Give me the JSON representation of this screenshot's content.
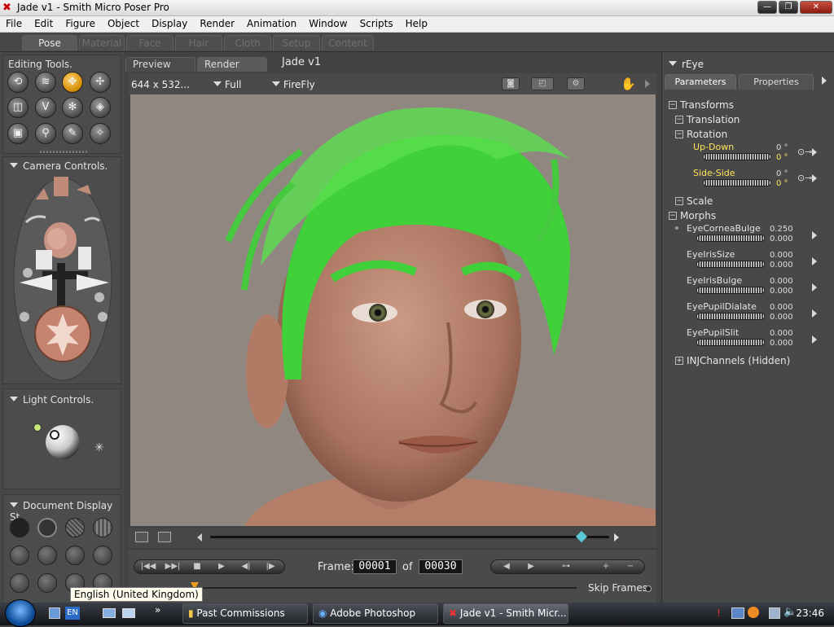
{
  "window": {
    "title": "Jade v1 - Smith Micro Poser Pro",
    "icon": "poser-icon"
  },
  "menu": [
    "File",
    "Edit",
    "Figure",
    "Object",
    "Display",
    "Render",
    "Animation",
    "Window",
    "Scripts",
    "Help"
  ],
  "rooms": [
    {
      "label": "Pose",
      "active": true
    },
    {
      "label": "Material",
      "active": false
    },
    {
      "label": "Face",
      "active": false
    },
    {
      "label": "Hair",
      "active": false
    },
    {
      "label": "Cloth",
      "active": false
    },
    {
      "label": "Setup",
      "active": false
    },
    {
      "label": "Content",
      "active": false
    }
  ],
  "left": {
    "editing_title": "Editing Tools.",
    "tools": [
      "rotate",
      "twist",
      "translate",
      "translate-in-out",
      "scale",
      "taper",
      "chain-break",
      "color",
      "view-magnifier",
      "direct-manipulation",
      "morphing",
      "grouping"
    ],
    "selected_tool": "translate",
    "camera_title": "Camera Controls.",
    "light_title": "Light Controls.",
    "doc_display_title": "Document Display St"
  },
  "document": {
    "tabs": [
      {
        "label": "Preview",
        "active": false
      },
      {
        "label": "Render",
        "active": true
      }
    ],
    "title": "Jade v1",
    "size": "644 x 532...",
    "quality": "Full",
    "renderer": "FireFly",
    "frame_label": "Frame:",
    "frame_current": "00001",
    "frame_of": "of",
    "frame_total": "00030",
    "skip_frames": "Skip Frames",
    "timeline_position": 0.93
  },
  "params": {
    "actor": "rEye",
    "tabs": [
      {
        "label": "Parameters",
        "active": true
      },
      {
        "label": "Properties",
        "active": false
      }
    ],
    "groups": {
      "transforms": "Transforms",
      "translation": "Translation",
      "rotation": "Rotation",
      "scale": "Scale",
      "morphs": "Morphs",
      "inj": "INJChannels (Hidden)"
    },
    "rotation_dials": [
      {
        "name": "Up-Down",
        "value": "0 °",
        "value2": "0 °"
      },
      {
        "name": "Side-Side",
        "value": "0 °",
        "value2": "0 °"
      }
    ],
    "morph_dials": [
      {
        "name": "EyeCorneaBulge",
        "value": "0.250",
        "value2": "0.000"
      },
      {
        "name": "EyeIrisSize",
        "value": "0.000",
        "value2": "0.000"
      },
      {
        "name": "EyeIrisBulge",
        "value": "0.000",
        "value2": "0.000"
      },
      {
        "name": "EyePupilDialate",
        "value": "0.000",
        "value2": "0.000"
      },
      {
        "name": "EyePupilSlit",
        "value": "0.000",
        "value2": "0.000"
      }
    ]
  },
  "taskbar": {
    "lang": "EN",
    "tooltip": "English (United Kingdom)",
    "tasks": [
      {
        "label": "Past Commissions",
        "active": false
      },
      {
        "label": "Adobe Photoshop",
        "active": false
      },
      {
        "label": "Jade v1 - Smith Micr...",
        "active": true
      }
    ],
    "clock": "23:46"
  },
  "colors": {
    "hair": "#3fd03a",
    "skin": "#c08e75",
    "background": "#918781",
    "accent": "#ffe45a"
  }
}
